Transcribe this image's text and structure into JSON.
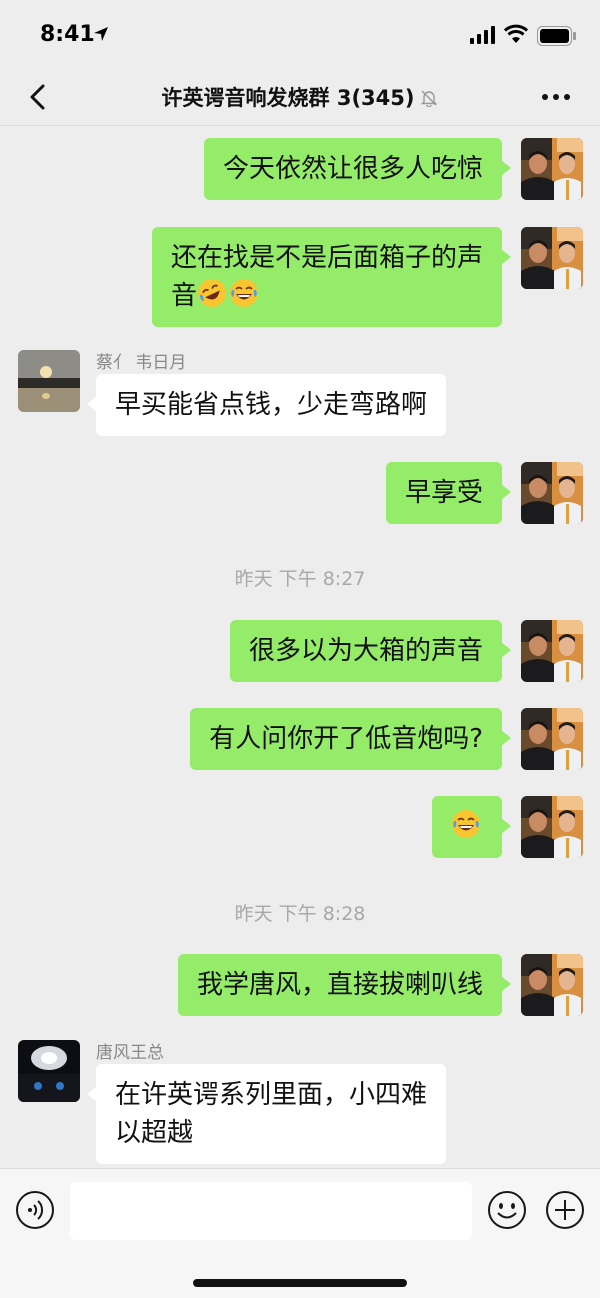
{
  "status_bar": {
    "time": "8:41"
  },
  "nav": {
    "title": "许英谔音响发烧群 3(345)"
  },
  "messages": [
    {
      "text": "今天依然让很多人吃惊"
    },
    {
      "text": "还在找是不是后面箱子的声",
      "text2": "音"
    },
    {
      "sender": "蔡亻 韦日月",
      "text": "早买能省点钱，少走弯路啊"
    },
    {
      "text": "早享受"
    },
    {
      "timestamp": "昨天 下午 8:27"
    },
    {
      "text": "很多以为大箱的声音"
    },
    {
      "text": "有人问你开了低音炮吗?"
    },
    {
      "emoji": "laughing-tears"
    },
    {
      "timestamp": "昨天 下午 8:28"
    },
    {
      "text": "我学唐风，直接拔喇叭线"
    },
    {
      "sender": "唐风王总",
      "text": "在许英谔系列里面，小四难",
      "text2": "以超越"
    }
  ],
  "input": {
    "placeholder": ""
  },
  "icons": {
    "back": "chevron-left-icon",
    "more": "more-dots-icon",
    "mute": "bell-muted-icon",
    "voice": "voice-icon",
    "emoji": "smiley-icon",
    "plus": "plus-icon"
  },
  "colors": {
    "my_bubble": "#95ec69",
    "other_bubble": "#ffffff",
    "background": "#ededed"
  }
}
